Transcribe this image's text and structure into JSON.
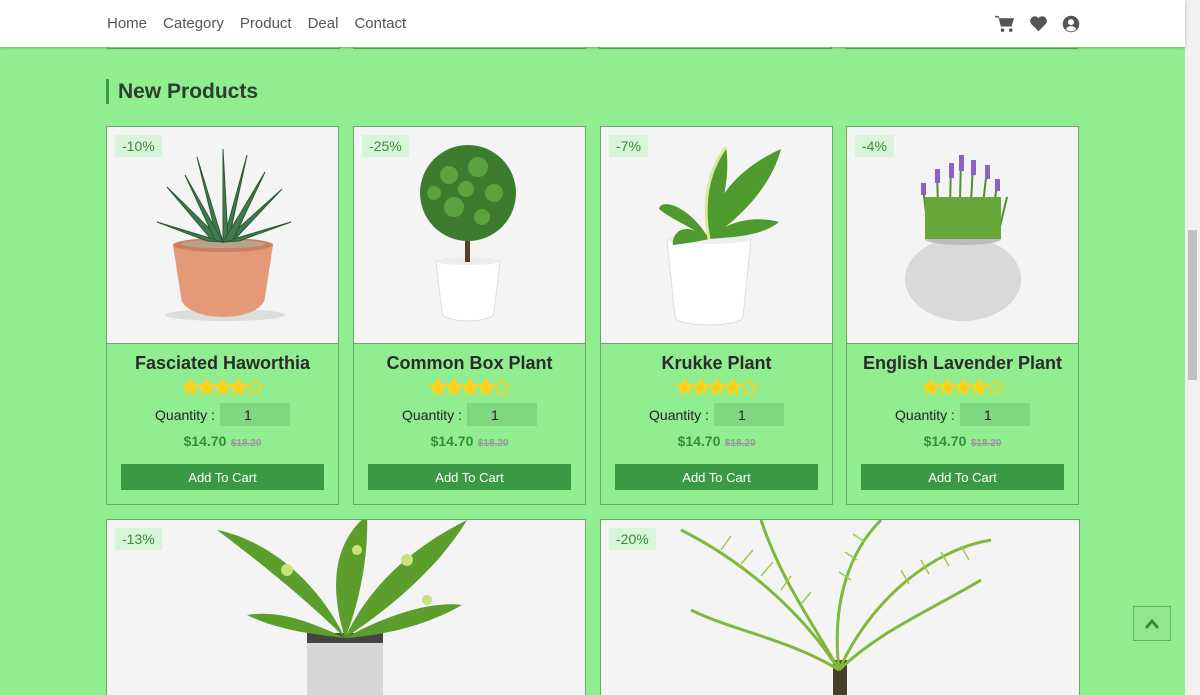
{
  "nav": {
    "links": [
      "Home",
      "Category",
      "Product",
      "Deal",
      "Contact"
    ],
    "icons": [
      "cart-icon",
      "heart-icon",
      "user-icon"
    ]
  },
  "section": {
    "title": "New Products"
  },
  "products": [
    {
      "name": "Fasciated Haworthia",
      "discount": "-10%",
      "rating": 4,
      "max_rating": 5,
      "quantity_label": "Quantity :",
      "quantity": "1",
      "price": "$14.70",
      "old_price": "$18.20",
      "button": "Add To Cart"
    },
    {
      "name": "Common Box Plant",
      "discount": "-25%",
      "rating": 4,
      "max_rating": 5,
      "quantity_label": "Quantity :",
      "quantity": "1",
      "price": "$14.70",
      "old_price": "$18.20",
      "button": "Add To Cart"
    },
    {
      "name": "Krukke Plant",
      "discount": "-7%",
      "rating": 4,
      "max_rating": 5,
      "quantity_label": "Quantity :",
      "quantity": "1",
      "price": "$14.70",
      "old_price": "$18.20",
      "button": "Add To Cart"
    },
    {
      "name": "English Lavender Plant",
      "discount": "-4%",
      "rating": 4,
      "max_rating": 5,
      "quantity_label": "Quantity :",
      "quantity": "1",
      "price": "$14.70",
      "old_price": "$18.20",
      "button": "Add To Cart"
    }
  ],
  "featured": [
    {
      "discount": "-13%"
    },
    {
      "discount": "-20%"
    }
  ],
  "colors": {
    "page_bg": "#90ee90",
    "accent": "#3a9a44",
    "star": "#ffd21f"
  }
}
